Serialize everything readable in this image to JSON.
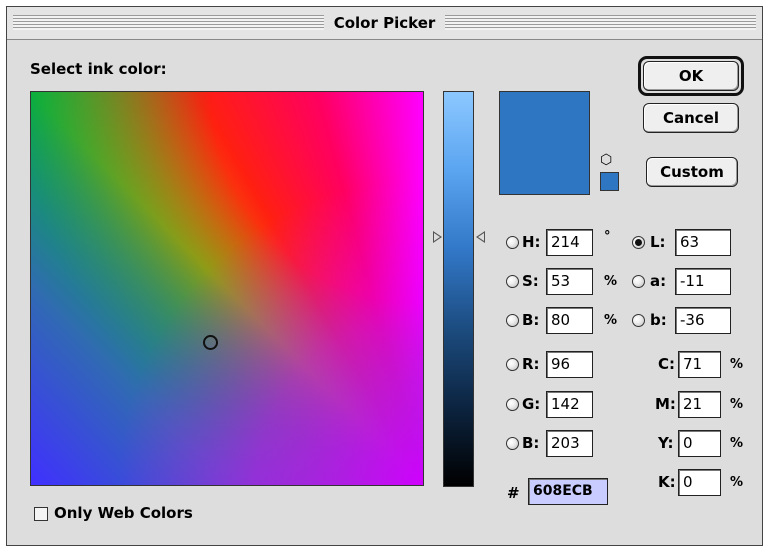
{
  "window": {
    "title": "Color Picker"
  },
  "prompt": "Select ink color:",
  "buttons": {
    "ok": "OK",
    "cancel": "Cancel",
    "custom": "Custom"
  },
  "colors": {
    "current": "#2E76C2",
    "field_marker": "#2E76C2",
    "hex_field_bg": "#C8CCFF"
  },
  "icons": {
    "gamut_warning": "cube-warning-icon"
  },
  "hsb": {
    "h": {
      "label": "H:",
      "value": "214",
      "unit": "°"
    },
    "s": {
      "label": "S:",
      "value": "53",
      "unit": "%"
    },
    "b": {
      "label": "B:",
      "value": "80",
      "unit": "%"
    }
  },
  "lab": {
    "l": {
      "label": "L:",
      "value": "63",
      "selected": true
    },
    "a": {
      "label": "a:",
      "value": "-11"
    },
    "b": {
      "label": "b:",
      "value": "-36"
    }
  },
  "rgb": {
    "r": {
      "label": "R:",
      "value": "96"
    },
    "g": {
      "label": "G:",
      "value": "142"
    },
    "b": {
      "label": "B:",
      "value": "203"
    }
  },
  "cmyk": {
    "c": {
      "label": "C:",
      "value": "71",
      "unit": "%"
    },
    "m": {
      "label": "M:",
      "value": "21",
      "unit": "%"
    },
    "y": {
      "label": "Y:",
      "value": "0",
      "unit": "%"
    },
    "k": {
      "label": "K:",
      "value": "0",
      "unit": "%"
    }
  },
  "hex": {
    "label": "#",
    "value": "608ECB"
  },
  "web_colors": {
    "label": "Only Web Colors",
    "checked": false
  }
}
